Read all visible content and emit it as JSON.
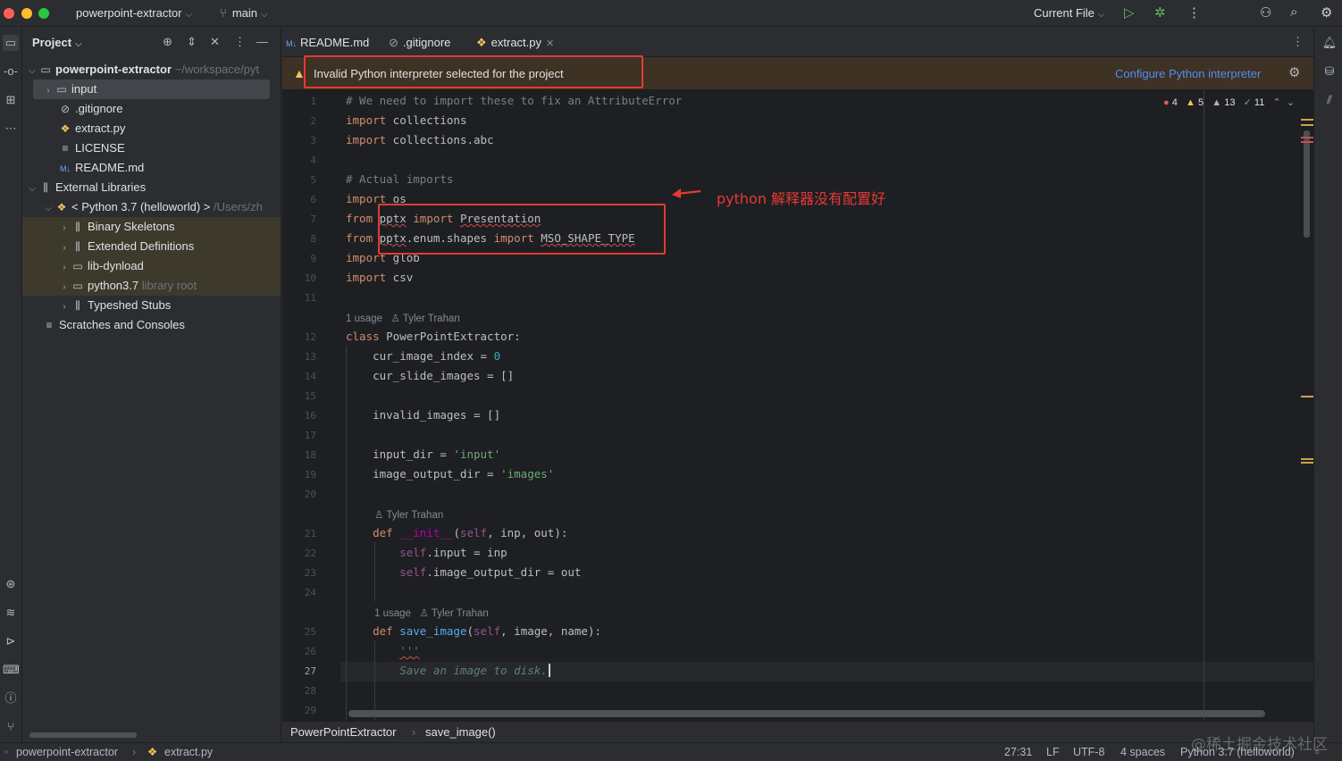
{
  "titlebar": {
    "project": "powerpoint-extractor",
    "branch": "main",
    "run_config": "Current File"
  },
  "project_panel": {
    "title": "Project",
    "tree": [
      {
        "label": "powerpoint-extractor",
        "suffix": "~/workspace/pyt"
      },
      {
        "label": "input"
      },
      {
        "label": ".gitignore"
      },
      {
        "label": "extract.py"
      },
      {
        "label": "LICENSE"
      },
      {
        "label": "README.md"
      },
      {
        "label": "External Libraries"
      },
      {
        "label": "< Python 3.7 (helloworld) >",
        "suffix": "/Users/zh"
      },
      {
        "label": "Binary Skeletons"
      },
      {
        "label": "Extended Definitions"
      },
      {
        "label": "lib-dynload"
      },
      {
        "label": "python3.7",
        "suffix": "library root"
      },
      {
        "label": "Typeshed Stubs"
      },
      {
        "label": "Scratches and Consoles"
      }
    ]
  },
  "tabs": [
    {
      "label": "README.md"
    },
    {
      "label": ".gitignore"
    },
    {
      "label": "extract.py"
    }
  ],
  "banner": {
    "message": "Invalid Python interpreter selected for the project",
    "action": "Configure Python interpreter"
  },
  "inspections": {
    "errors": "4",
    "warnings": "5",
    "weak": "13",
    "ok": "11"
  },
  "annotation": "python 解释器没有配置好",
  "code": {
    "l1": "# We need to import these to fix an AttributeError",
    "l2": "import collections",
    "l3": "import collections.abc",
    "l5": "# Actual imports",
    "hint_usage_1": "1 usage",
    "hint_author": "Tyler Trahan",
    "hint_usage_2": "1 usage",
    "l26": "'''",
    "l27": "Save an image to disk."
  },
  "breadcrumb": {
    "class": "PowerPointExtractor",
    "method": "save_image()"
  },
  "status": {
    "project": "powerpoint-extractor",
    "file": "extract.py",
    "position": "27:31",
    "line_sep": "LF",
    "encoding": "UTF-8",
    "indent": "4 spaces",
    "interpreter": "Python 3.7 (helloworld)",
    "watermark": "@稀土掘金技术社区"
  },
  "colors": {
    "accent": "#3574f0",
    "annotation": "#e53935",
    "warning": "#f2c55c"
  }
}
